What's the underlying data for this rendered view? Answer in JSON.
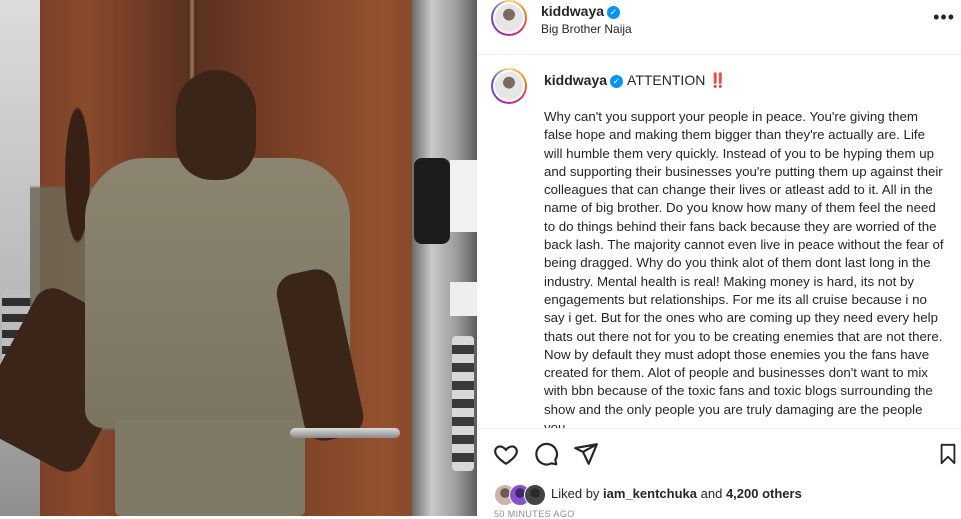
{
  "post": {
    "header": {
      "username": "kiddwaya",
      "verified": true,
      "subtitle": "Big Brother Naija"
    },
    "caption": {
      "username": "kiddwaya",
      "title": "ATTENTION ‼️",
      "body": "Why can't you support your people in peace. You're giving them false hope and making them bigger than they're actually are. Life will humble them very quickly. Instead of you to be hyping them up and supporting their businesses you're putting them up against their colleagues that can change their lives or atleast add to it. All in the name of big brother. Do you know how many of them feel the need to do things behind their fans back because they are worried of the back lash. The majority cannot even live in peace without the fear of being dragged. Why do you think alot of them dont last long in the industry. Mental health is real! Making money is hard, its not by engagements but relationships. For me its all cruise because i no say i get. But for the ones who are coming up they need every help thats out there not for you to be creating enemies that are not there. Now by default they must adopt those enemies you the fans have created for them. Alot of people and businesses don't want to mix with bbn because of the toxic fans and toxic blogs surrounding the show and the only people you are truly damaging are the people you"
    },
    "likes": {
      "prefix": "Liked by",
      "liker": "iam_kentchuka",
      "and": "and",
      "count": "4,200 others"
    },
    "timestamp": "50 MINUTES AGO"
  },
  "icons": {
    "more": "more-options-icon",
    "like": "heart-icon",
    "comment": "comment-icon",
    "share": "share-icon",
    "save": "bookmark-icon",
    "verified": "verified-badge-icon"
  },
  "colors": {
    "verified": "#0095f6",
    "text": "#262626",
    "muted": "#8e8e8e"
  }
}
